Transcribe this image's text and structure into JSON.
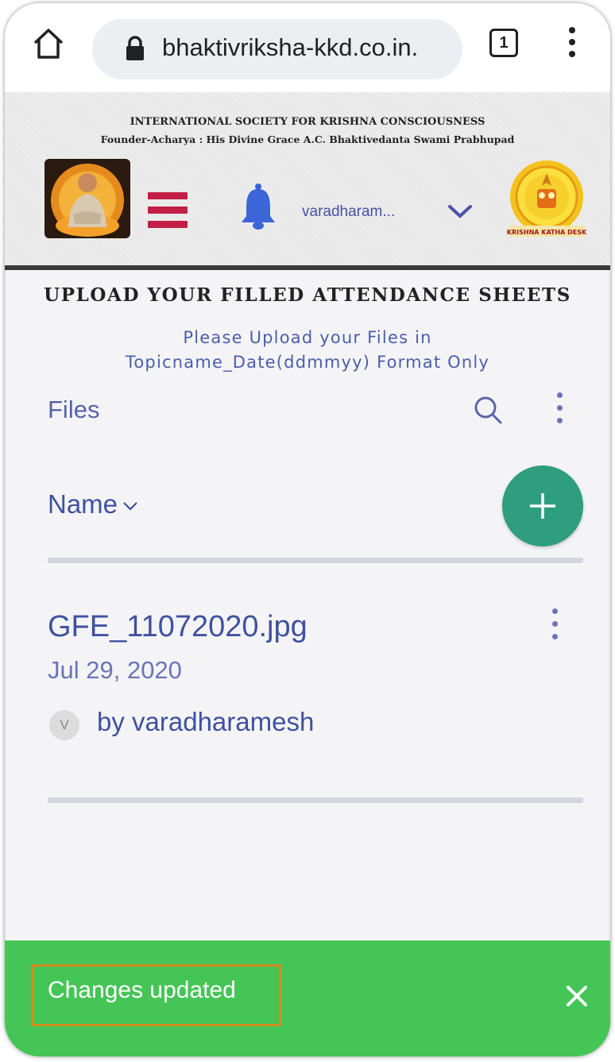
{
  "browser": {
    "url": "bhaktivriksha-kkd.co.in.",
    "tab_count": "1"
  },
  "site_header": {
    "org_name": "INTERNATIONAL SOCIETY FOR KRISHNA CONSCIOUSNESS",
    "founder_line": "Founder-Acharya : His Divine Grace A.C. Bhaktivedanta Swami Prabhupad",
    "user_display": "varadharam...",
    "right_logo_text": "KRISHNA KATHA DESK"
  },
  "page": {
    "title": "UPLOAD YOUR FILLED ATTENDANCE SHEETS",
    "instruction_line1": "Please Upload your Files in",
    "instruction_line2": "Topicname_Date(ddmmyy) Format Only"
  },
  "files": {
    "label": "Files",
    "sort_label": "Name",
    "items": [
      {
        "name": "GFE_11072020.jpg",
        "date": "Jul 29, 2020",
        "avatar_initial": "V",
        "owner": "by varadharamesh"
      }
    ]
  },
  "toast": {
    "message": "Changes updated"
  },
  "colors": {
    "accent_blue": "#3f51a0",
    "fab_green": "#2f9e7f",
    "toast_green": "#45c556",
    "menu_red": "#c31e45",
    "highlight_orange": "#d48b22"
  }
}
